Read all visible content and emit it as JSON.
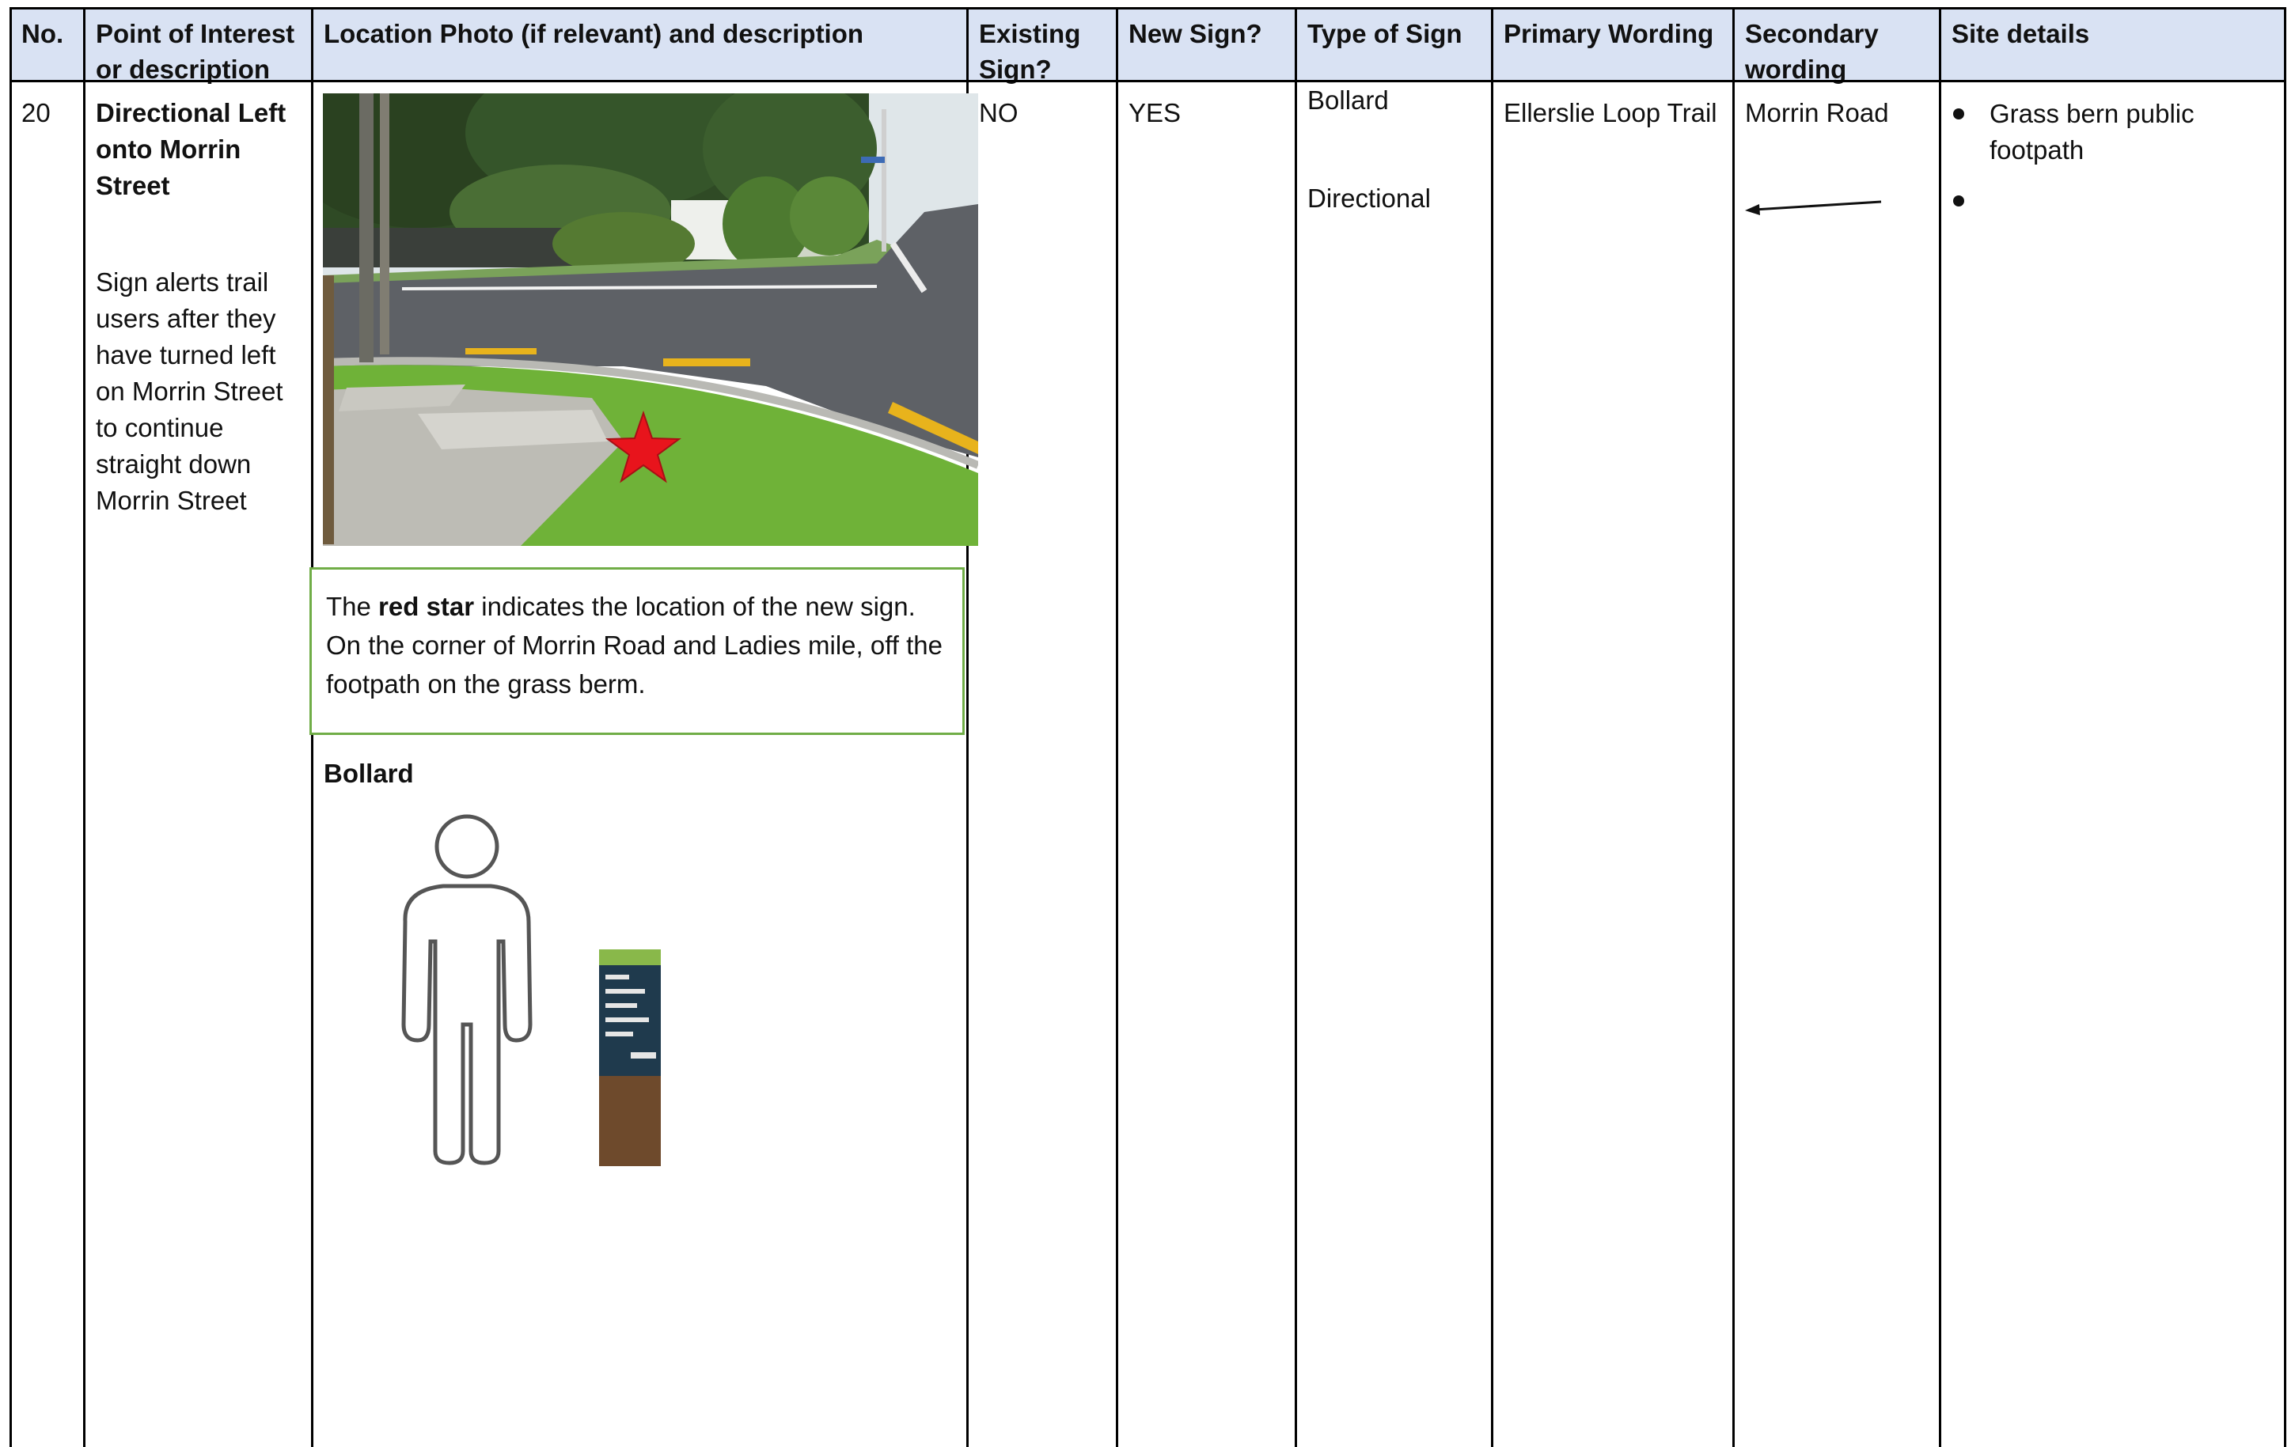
{
  "table": {
    "headers": [
      "No.",
      "Point of Interest or description",
      "Location Photo (if relevant) and description",
      "Existing Sign?",
      "New Sign?",
      "Type of Sign",
      "Primary Wording",
      "Secondary wording",
      "Site details"
    ],
    "row": {
      "number": "20",
      "poi_title": "Directional Left onto Morrin Street",
      "poi_description": "Sign alerts trail users after they have turned left on Morrin Street to continue straight down Morrin Street",
      "caption_pre": "The ",
      "caption_bold": "red star",
      "caption_post": " indicates the location of the new sign. On the corner of Morrin Road and Ladies mile, off the footpath on the grass berm.",
      "sign_heading": "Bollard",
      "existing_sign": "NO",
      "new_sign": "YES",
      "sign_type_1": "Bollard",
      "sign_type_2": "Directional",
      "primary_wording": "Ellerslie Loop Trail",
      "secondary_wording": "Morrin Road",
      "site_details": [
        "Grass bern public footpath",
        ""
      ]
    }
  },
  "icons": [
    "red-star-icon",
    "person-outline-icon",
    "bollard-sign-icon",
    "left-arrow-icon"
  ],
  "colors": {
    "header_bg": "#d9e2f3",
    "caption_border": "#70ad47",
    "star": "#e8141c",
    "grass": "#6fb238",
    "bollard_panel": "#1f3a4d"
  }
}
